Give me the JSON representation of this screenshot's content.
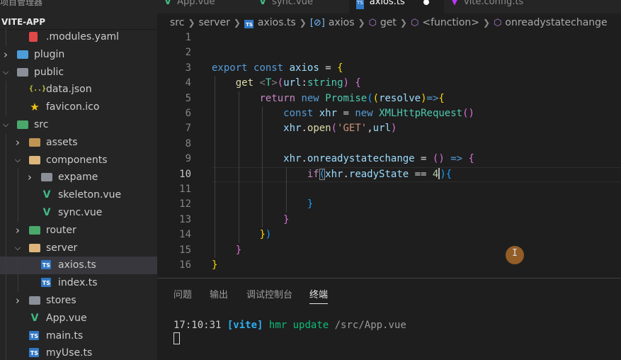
{
  "sidebar": {
    "top_text": "项目管理器",
    "project": "VITE-APP",
    "items": [
      {
        "label": ".modules.yaml",
        "depth": 1,
        "expanded": null,
        "icon": "yaml-icon"
      },
      {
        "label": "plugin",
        "depth": 0,
        "expanded": false,
        "icon": "folder-icon"
      },
      {
        "label": "public",
        "depth": 0,
        "expanded": true,
        "icon": "folder-icon"
      },
      {
        "label": "data.json",
        "depth": 1,
        "expanded": null,
        "icon": "json-icon"
      },
      {
        "label": "favicon.ico",
        "depth": 1,
        "expanded": null,
        "icon": "star-icon"
      },
      {
        "label": "src",
        "depth": 0,
        "expanded": true,
        "icon": "folder-icon"
      },
      {
        "label": "assets",
        "depth": 1,
        "expanded": false,
        "icon": "folder-icon"
      },
      {
        "label": "components",
        "depth": 1,
        "expanded": true,
        "icon": "folder-icon"
      },
      {
        "label": "expame",
        "depth": 2,
        "expanded": false,
        "icon": "folder-icon"
      },
      {
        "label": "skeleton.vue",
        "depth": 2,
        "expanded": null,
        "icon": "vue-icon"
      },
      {
        "label": "sync.vue",
        "depth": 2,
        "expanded": null,
        "icon": "vue-icon"
      },
      {
        "label": "router",
        "depth": 1,
        "expanded": false,
        "icon": "folder-icon"
      },
      {
        "label": "server",
        "depth": 1,
        "expanded": true,
        "icon": "folder-icon"
      },
      {
        "label": "axios.ts",
        "depth": 2,
        "expanded": null,
        "icon": "ts-icon",
        "selected": true
      },
      {
        "label": "index.ts",
        "depth": 2,
        "expanded": null,
        "icon": "ts-icon"
      },
      {
        "label": "stores",
        "depth": 1,
        "expanded": false,
        "icon": "folder-icon"
      },
      {
        "label": "App.vue",
        "depth": 1,
        "expanded": null,
        "icon": "vue-icon"
      },
      {
        "label": "main.ts",
        "depth": 1,
        "expanded": null,
        "icon": "ts-icon"
      },
      {
        "label": "myUse.ts",
        "depth": 1,
        "expanded": null,
        "icon": "ts-icon"
      }
    ]
  },
  "tabs": [
    {
      "label": "App.vue",
      "icon": "vue-icon",
      "active": false
    },
    {
      "label": "sync.vue",
      "icon": "vue-icon",
      "active": false
    },
    {
      "label": "axios.ts",
      "icon": "ts-icon",
      "active": true,
      "modified": true
    },
    {
      "label": "vite.config.ts",
      "icon": "vite-icon",
      "active": false
    }
  ],
  "breadcrumb": [
    "src",
    "server",
    "axios.ts",
    "axios",
    "get",
    "<function>",
    "onreadystatechange"
  ],
  "editor": {
    "current_line": 10,
    "lines": [
      "",
      "",
      "export const axios = {",
      "    get <T>(url:string) {",
      "        return new Promise((resolve)=>{",
      "            const xhr = new XMLHttpRequest()",
      "            xhr.open('GET',url)",
      "",
      "            xhr.onreadystatechange = () => {",
      "                if(xhr.readyState == 4){",
      "",
      "                }",
      "            }",
      "        })",
      "    }",
      "}"
    ]
  },
  "panel": {
    "tabs": [
      "问题",
      "输出",
      "调试控制台",
      "终端"
    ],
    "active_tab": "终端",
    "terminal": {
      "time": "17:10:31",
      "tag": "[vite]",
      "message": "hmr update",
      "path": "/src/App.vue"
    }
  },
  "cursor_label": "I"
}
